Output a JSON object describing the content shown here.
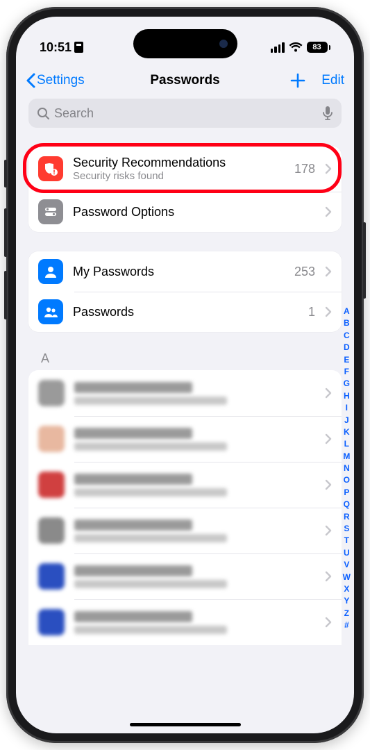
{
  "status": {
    "time": "10:51",
    "battery": "83"
  },
  "nav": {
    "back": "Settings",
    "title": "Passwords",
    "edit": "Edit"
  },
  "search": {
    "placeholder": "Search"
  },
  "rows": {
    "security": {
      "title": "Security Recommendations",
      "sub": "Security risks found",
      "count": "178"
    },
    "options": {
      "title": "Password Options"
    },
    "my": {
      "title": "My Passwords",
      "count": "253"
    },
    "shared": {
      "title": "Passwords",
      "count": "1"
    }
  },
  "section_a": "A",
  "index": [
    "A",
    "B",
    "C",
    "D",
    "E",
    "F",
    "G",
    "H",
    "I",
    "J",
    "K",
    "L",
    "M",
    "N",
    "O",
    "P",
    "Q",
    "R",
    "S",
    "T",
    "U",
    "V",
    "W",
    "X",
    "Y",
    "Z",
    "#"
  ],
  "favicons": [
    "#9a9a9a",
    "#e8b8a0",
    "#d04040",
    "#8a8a8a",
    "#2a4fc0",
    "#2a4fc0"
  ]
}
